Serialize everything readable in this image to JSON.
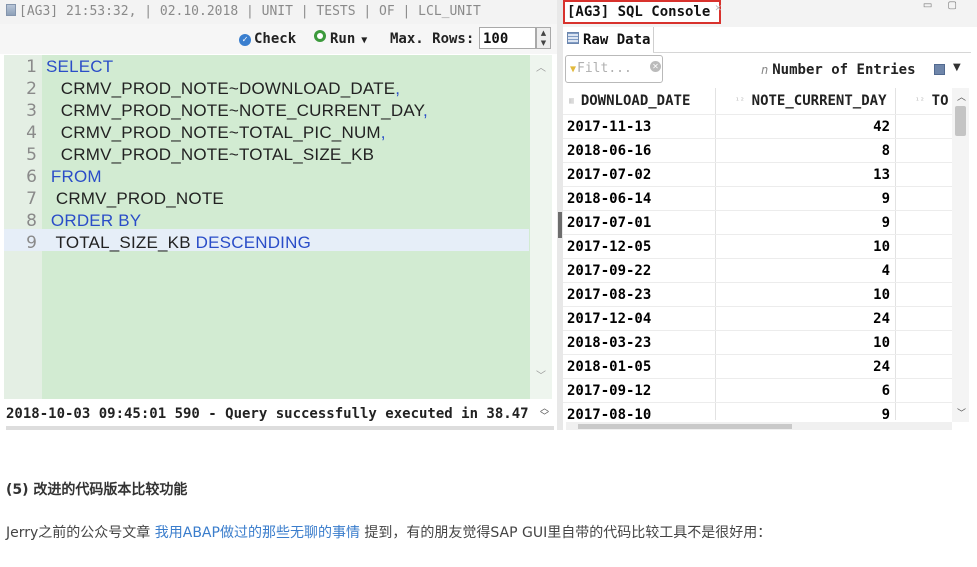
{
  "left_tab": {
    "title": "[AG3] 21:53:32, | 02.10.2018 | UNIT | TESTS | OF | LCL_UNIT"
  },
  "toolbar": {
    "check_label": "Check",
    "run_label": "Run",
    "max_rows_label": "Max. Rows:",
    "max_rows_value": "100"
  },
  "editor": {
    "lines": [
      {
        "num": "1",
        "kw": "SELECT",
        "text": "",
        "punc": ""
      },
      {
        "num": "2",
        "kw": "",
        "text": "   CRMV_PROD_NOTE~DOWNLOAD_DATE",
        "punc": ","
      },
      {
        "num": "3",
        "kw": "",
        "text": "   CRMV_PROD_NOTE~NOTE_CURRENT_DAY",
        "punc": ","
      },
      {
        "num": "4",
        "kw": "",
        "text": "   CRMV_PROD_NOTE~TOTAL_PIC_NUM",
        "punc": ","
      },
      {
        "num": "5",
        "kw": "",
        "text": "   CRMV_PROD_NOTE~TOTAL_SIZE_KB",
        "punc": ""
      },
      {
        "num": "6",
        "kw": " FROM",
        "text": "",
        "punc": ""
      },
      {
        "num": "7",
        "kw": "",
        "text": "  CRMV_PROD_NOTE",
        "punc": ""
      },
      {
        "num": "8",
        "kw": " ORDER BY",
        "text": "",
        "punc": ""
      },
      {
        "num": "9",
        "kw": "",
        "text": "  TOTAL_SIZE_KB ",
        "punc": "DESCENDING"
      }
    ]
  },
  "status": {
    "message": "2018-10-03 09:45:01 590 - Query successfully executed in 38.47"
  },
  "right_tab": {
    "title": "[AG3] SQL Console",
    "close": "✕"
  },
  "raw_data_tab": {
    "label": "Raw Data"
  },
  "filter": {
    "placeholder": "Filt..."
  },
  "entries": {
    "label": "Number of Entries"
  },
  "grid": {
    "columns": [
      "DOWNLOAD_DATE",
      "NOTE_CURRENT_DAY",
      "TO"
    ],
    "rows": [
      [
        "2017-11-13",
        "42"
      ],
      [
        "2018-06-16",
        "8"
      ],
      [
        "2017-07-02",
        "13"
      ],
      [
        "2018-06-14",
        "9"
      ],
      [
        "2017-07-01",
        "9"
      ],
      [
        "2017-12-05",
        "10"
      ],
      [
        "2017-09-22",
        "4"
      ],
      [
        "2017-08-23",
        "10"
      ],
      [
        "2017-12-04",
        "24"
      ],
      [
        "2018-03-23",
        "10"
      ],
      [
        "2018-01-05",
        "24"
      ],
      [
        "2017-09-12",
        "6"
      ],
      [
        "2017-08-10",
        "9"
      ]
    ]
  },
  "article": {
    "heading": "(5) 改进的代码版本比较功能",
    "para_before": "Jerry之前的公众号文章 ",
    "link_text": "我用ABAP做过的那些无聊的事情",
    "para_after": " 提到，有的朋友觉得SAP GUI里自带的代码比较工具不是很好用："
  },
  "colors": {
    "editor_bg": "#d2ebd2",
    "keyword": "#2a4dc8",
    "highlight_border": "#d8322d",
    "link": "#3a7dcc"
  },
  "icons": [
    "tab-icon",
    "check-icon",
    "run-icon",
    "grid-icon",
    "filter-icon",
    "save-icon",
    "menu-caret-icon"
  ]
}
